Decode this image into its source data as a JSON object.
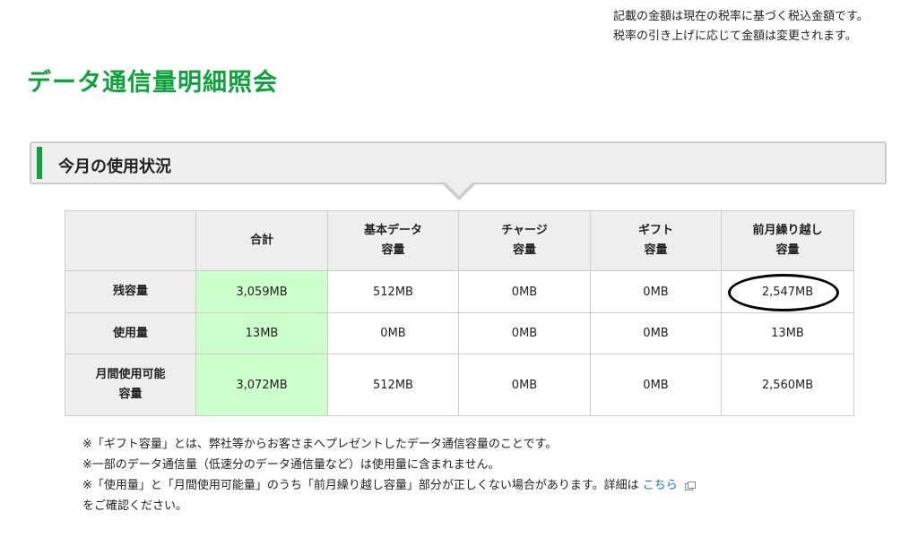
{
  "tax_note": {
    "line1": "記載の金額は現在の税率に基づく税込金額です。",
    "line2": "税率の引き上げに応じて金額は変更されます。"
  },
  "page_title": "データ通信量明細照会",
  "section": {
    "title": "今月の使用状況"
  },
  "table": {
    "headers": [
      {
        "line1": "合計",
        "line2": ""
      },
      {
        "line1": "基本データ",
        "line2": "容量"
      },
      {
        "line1": "チャージ",
        "line2": "容量"
      },
      {
        "line1": "ギフト",
        "line2": "容量"
      },
      {
        "line1": "前月繰り越し",
        "line2": "容量"
      }
    ],
    "rows": [
      {
        "label1": "残容量",
        "label2": "",
        "values": [
          "3,059MB",
          "512MB",
          "0MB",
          "0MB",
          "2,547MB"
        ]
      },
      {
        "label1": "使用量",
        "label2": "",
        "values": [
          "13MB",
          "0MB",
          "0MB",
          "0MB",
          "13MB"
        ]
      },
      {
        "label1": "月間使用可能",
        "label2": "容量",
        "values": [
          "3,072MB",
          "512MB",
          "0MB",
          "0MB",
          "2,560MB"
        ]
      }
    ]
  },
  "notes": {
    "note1": "※「ギフト容量」とは、弊社等からお客さまへプレゼントしたデータ通信容量のことです。",
    "note2": "※一部のデータ通信量（低速分のデータ通信量など）は使用量に含まれません。",
    "note3_prefix": "※「使用量」と「月間使用可能量」のうち「前月繰り越し容量」部分が正しくない場合があります。詳細は",
    "note3_link": "こちら",
    "note3_suffix": "をご確認ください。"
  },
  "colors": {
    "title_green": "#10a23c",
    "total_column_bg": "#ccffcc",
    "header_bg": "#eeeeee",
    "link_blue": "#1a6fc8"
  },
  "icons": {
    "link_icon": "external-window-icon"
  }
}
